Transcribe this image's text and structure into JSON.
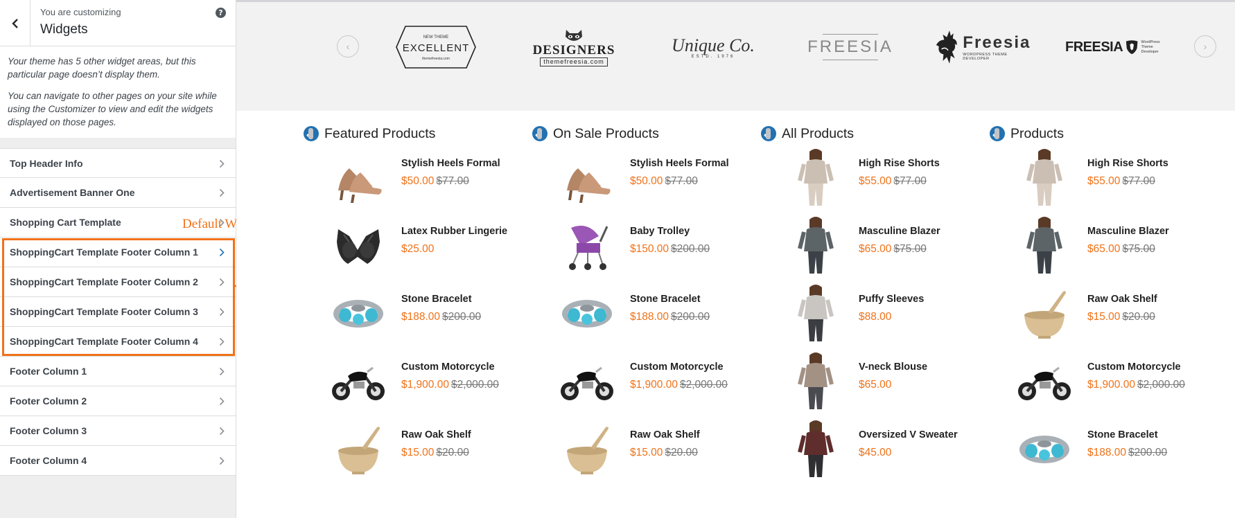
{
  "sidebar": {
    "header": {
      "small": "You are customizing",
      "title": "Widgets"
    },
    "notice": [
      "Your theme has 5 other widget areas, but this particular page doesn’t display them.",
      "You can navigate to other pages on your site while using the Customizer to view and edit the widgets displayed on those pages."
    ],
    "items": [
      {
        "label": "Top Header Info"
      },
      {
        "label": "Advertisement Banner One"
      },
      {
        "label": "Shopping Cart Template"
      },
      {
        "label": "ShoppingCart Template Footer Column 1"
      },
      {
        "label": "ShoppingCart Template Footer Column 2"
      },
      {
        "label": "ShoppingCart Template Footer Column 3"
      },
      {
        "label": "ShoppingCart Template Footer Column 4"
      },
      {
        "label": "Footer Column 1"
      },
      {
        "label": "Footer Column 2"
      },
      {
        "label": "Footer Column 3"
      },
      {
        "label": "Footer Column 4"
      }
    ]
  },
  "annotation": {
    "label": "Default WooCommerce Widgets",
    "color": "#f07219"
  },
  "brands": {
    "prev_icon": "chevron-left-icon",
    "next_icon": "chevron-right-icon",
    "logos": [
      {
        "top": "NEW THEME",
        "main": "EXCELLENT",
        "sub": "themefreesia.com"
      },
      {
        "main": "DESIGNERS",
        "sub": "themefreesia.com"
      },
      {
        "main": "Unique Co.",
        "sub": "ESTD. 1976"
      },
      {
        "main": "FREESIA"
      },
      {
        "main": "Freesia",
        "sub": "WORDPRESS THEME DEVELOPER"
      },
      {
        "main": "FREESIA",
        "sub1": "WordPress",
        "sub2": "Theme Developer"
      }
    ]
  },
  "colors": {
    "price": "#f07219",
    "accent": "#2271b1"
  },
  "columns": [
    {
      "title": "Featured Products",
      "products": [
        {
          "name": "Stylish Heels Formal",
          "price": "$50.00",
          "was": "$77.00",
          "img": "heels"
        },
        {
          "name": "Latex Rubber Lingerie",
          "price": "$25.00",
          "was": "",
          "img": "lingerie"
        },
        {
          "name": "Stone Bracelet",
          "price": "$188.00",
          "was": "$200.00",
          "img": "bracelet"
        },
        {
          "name": "Custom Motorcycle",
          "price": "$1,900.00",
          "was": "$2,000.00",
          "img": "motorcycle"
        },
        {
          "name": "Raw Oak Shelf",
          "price": "$15.00",
          "was": "$20.00",
          "img": "mortar"
        }
      ]
    },
    {
      "title": "On Sale Products",
      "products": [
        {
          "name": "Stylish Heels Formal",
          "price": "$50.00",
          "was": "$77.00",
          "img": "heels"
        },
        {
          "name": "Baby Trolley",
          "price": "$150.00",
          "was": "$200.00",
          "img": "stroller"
        },
        {
          "name": "Stone Bracelet",
          "price": "$188.00",
          "was": "$200.00",
          "img": "bracelet"
        },
        {
          "name": "Custom Motorcycle",
          "price": "$1,900.00",
          "was": "$2,000.00",
          "img": "motorcycle"
        },
        {
          "name": "Raw Oak Shelf",
          "price": "$15.00",
          "was": "$20.00",
          "img": "mortar"
        }
      ]
    },
    {
      "title": "All Products",
      "products": [
        {
          "name": "High Rise Shorts",
          "price": "$55.00",
          "was": "$77.00",
          "img": "model-beige"
        },
        {
          "name": "Masculine Blazer",
          "price": "$65.00",
          "was": "$75.00",
          "img": "model-grey"
        },
        {
          "name": "Puffy Sleeves",
          "price": "$88.00",
          "was": "",
          "img": "model-light"
        },
        {
          "name": "V-neck Blouse",
          "price": "$65.00",
          "was": "",
          "img": "model-taupe"
        },
        {
          "name": "Oversized V Sweater",
          "price": "$45.00",
          "was": "",
          "img": "model-maroon"
        }
      ]
    },
    {
      "title": "Products",
      "products": [
        {
          "name": "High Rise Shorts",
          "price": "$55.00",
          "was": "$77.00",
          "img": "model-beige"
        },
        {
          "name": "Masculine Blazer",
          "price": "$65.00",
          "was": "$75.00",
          "img": "model-grey"
        },
        {
          "name": "Raw Oak Shelf",
          "price": "$15.00",
          "was": "$20.00",
          "img": "mortar"
        },
        {
          "name": "Custom Motorcycle",
          "price": "$1,900.00",
          "was": "$2,000.00",
          "img": "motorcycle"
        },
        {
          "name": "Stone Bracelet",
          "price": "$188.00",
          "was": "$200.00",
          "img": "bracelet"
        }
      ]
    }
  ]
}
